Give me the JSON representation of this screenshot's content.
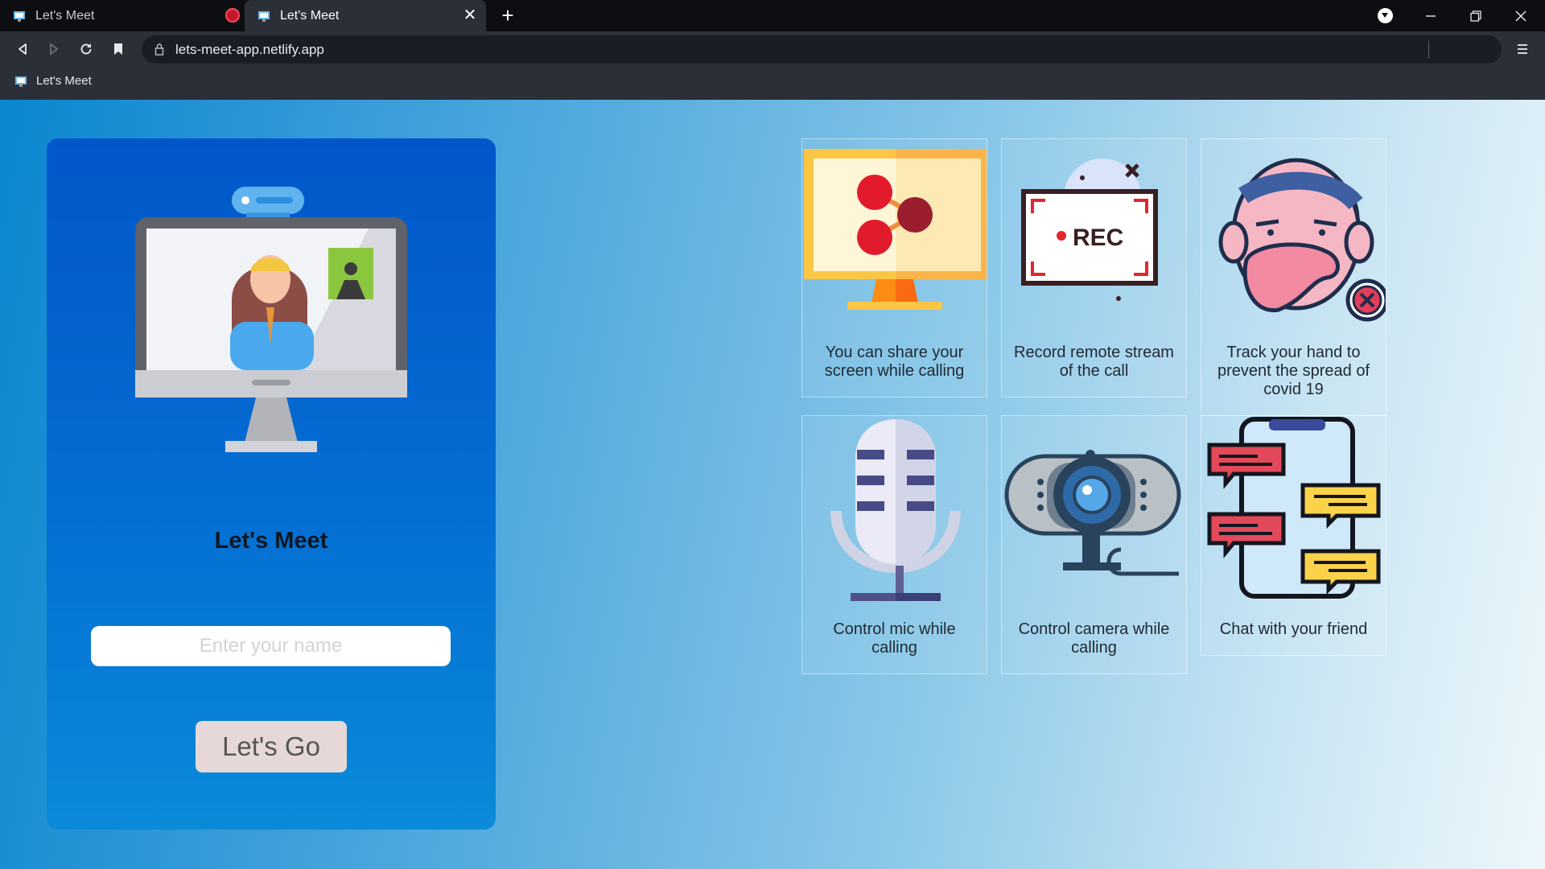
{
  "browser": {
    "tabs": [
      {
        "title": "Let's Meet",
        "active": false,
        "recording": true
      },
      {
        "title": "Let's Meet",
        "active": true
      }
    ],
    "url": "lets-meet-app.netlify.app",
    "bookmarks": [
      {
        "label": "Let's Meet"
      }
    ],
    "notification_count": "1"
  },
  "login": {
    "brand": "Let's Meet",
    "name_placeholder": "Enter your name",
    "name_value": "",
    "submit_label": "Let's Go"
  },
  "features": [
    {
      "caption": "You can share your screen while calling",
      "icon": "screen-share-icon"
    },
    {
      "caption": "Record remote stream of the call",
      "icon": "record-icon"
    },
    {
      "caption": "Track your hand to prevent the spread of covid 19",
      "icon": "hand-face-icon"
    },
    {
      "caption": "Control mic while calling",
      "icon": "microphone-icon"
    },
    {
      "caption": "Control camera while calling",
      "icon": "webcam-icon"
    },
    {
      "caption": "Chat with your friend",
      "icon": "chat-icon"
    }
  ],
  "colors": {
    "card_top": "#0256c9",
    "card_bottom": "#0a8bd9",
    "button_bg": "#e6d8d8",
    "recording": "#c2182e"
  }
}
